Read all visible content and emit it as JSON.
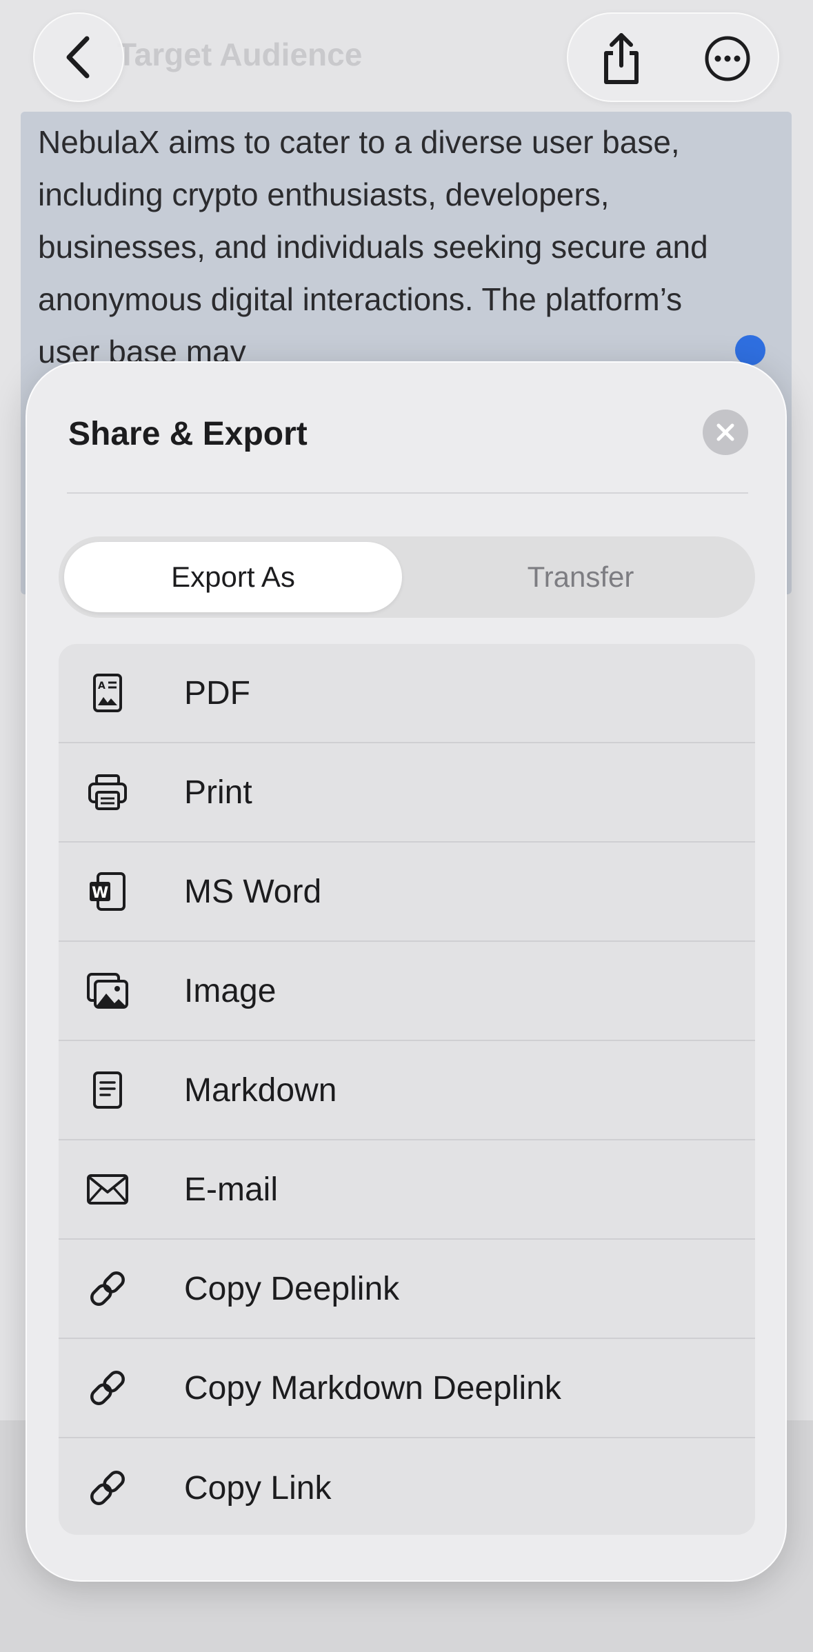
{
  "background": {
    "title": "Target Audience",
    "paragraph": "NebulaX aims to cater to a diverse user base, including crypto enthusiasts, developers, businesses, and individuals seeking secure and anonymous digital interactions. The platform’s user base may",
    "back_icon": "chevron-left-icon",
    "share_icon": "share-icon",
    "more_icon": "ellipsis-circle-icon"
  },
  "sheet": {
    "title": "Share & Export",
    "close_icon": "close-icon",
    "tabs": [
      {
        "label": "Export As",
        "active": true
      },
      {
        "label": "Transfer",
        "active": false
      }
    ],
    "items": [
      {
        "label": "PDF",
        "icon": "pdf-icon"
      },
      {
        "label": "Print",
        "icon": "printer-icon"
      },
      {
        "label": "MS Word",
        "icon": "word-icon"
      },
      {
        "label": "Image",
        "icon": "image-icon"
      },
      {
        "label": "Markdown",
        "icon": "document-icon"
      },
      {
        "label": "E-mail",
        "icon": "envelope-icon"
      },
      {
        "label": "Copy Deeplink",
        "icon": "link-icon"
      },
      {
        "label": "Copy Markdown Deeplink",
        "icon": "link-icon"
      },
      {
        "label": "Copy Link",
        "icon": "link-icon"
      }
    ]
  },
  "colors": {
    "accent_dot": "#2f6fe0",
    "sheet_bg": "#ececee",
    "list_bg": "#e2e2e4"
  }
}
